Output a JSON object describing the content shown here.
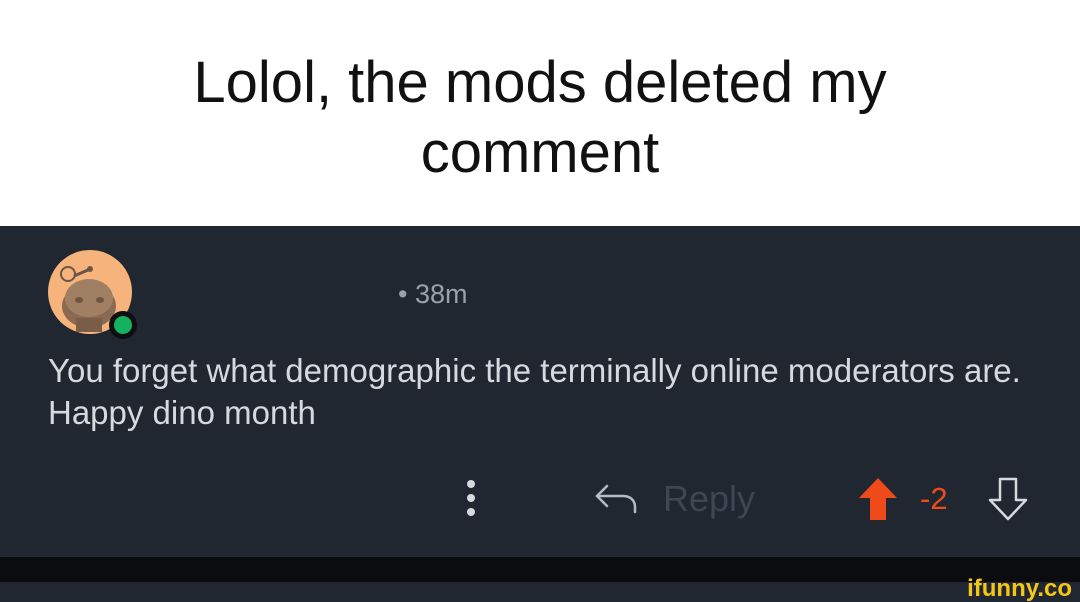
{
  "caption": {
    "text": "Lolol, the mods deleted my comment"
  },
  "comment": {
    "avatar_icon": "snoo-avatar-icon",
    "online_status_color": "#14b15e",
    "timestamp": "• 38m",
    "body": "You forget what demographic  the terminally online moderators are. Happy dino month"
  },
  "actions": {
    "more_icon": "vertical-dots-icon",
    "reply_icon": "reply-arrow-icon",
    "reply_label": "Reply",
    "upvote_icon": "upvote-arrow-icon",
    "upvote_color": "#f04a1a",
    "score": "-2",
    "downvote_icon": "downvote-arrow-icon"
  },
  "watermark": {
    "text": "ifunny.co",
    "color": "#f5c518"
  }
}
